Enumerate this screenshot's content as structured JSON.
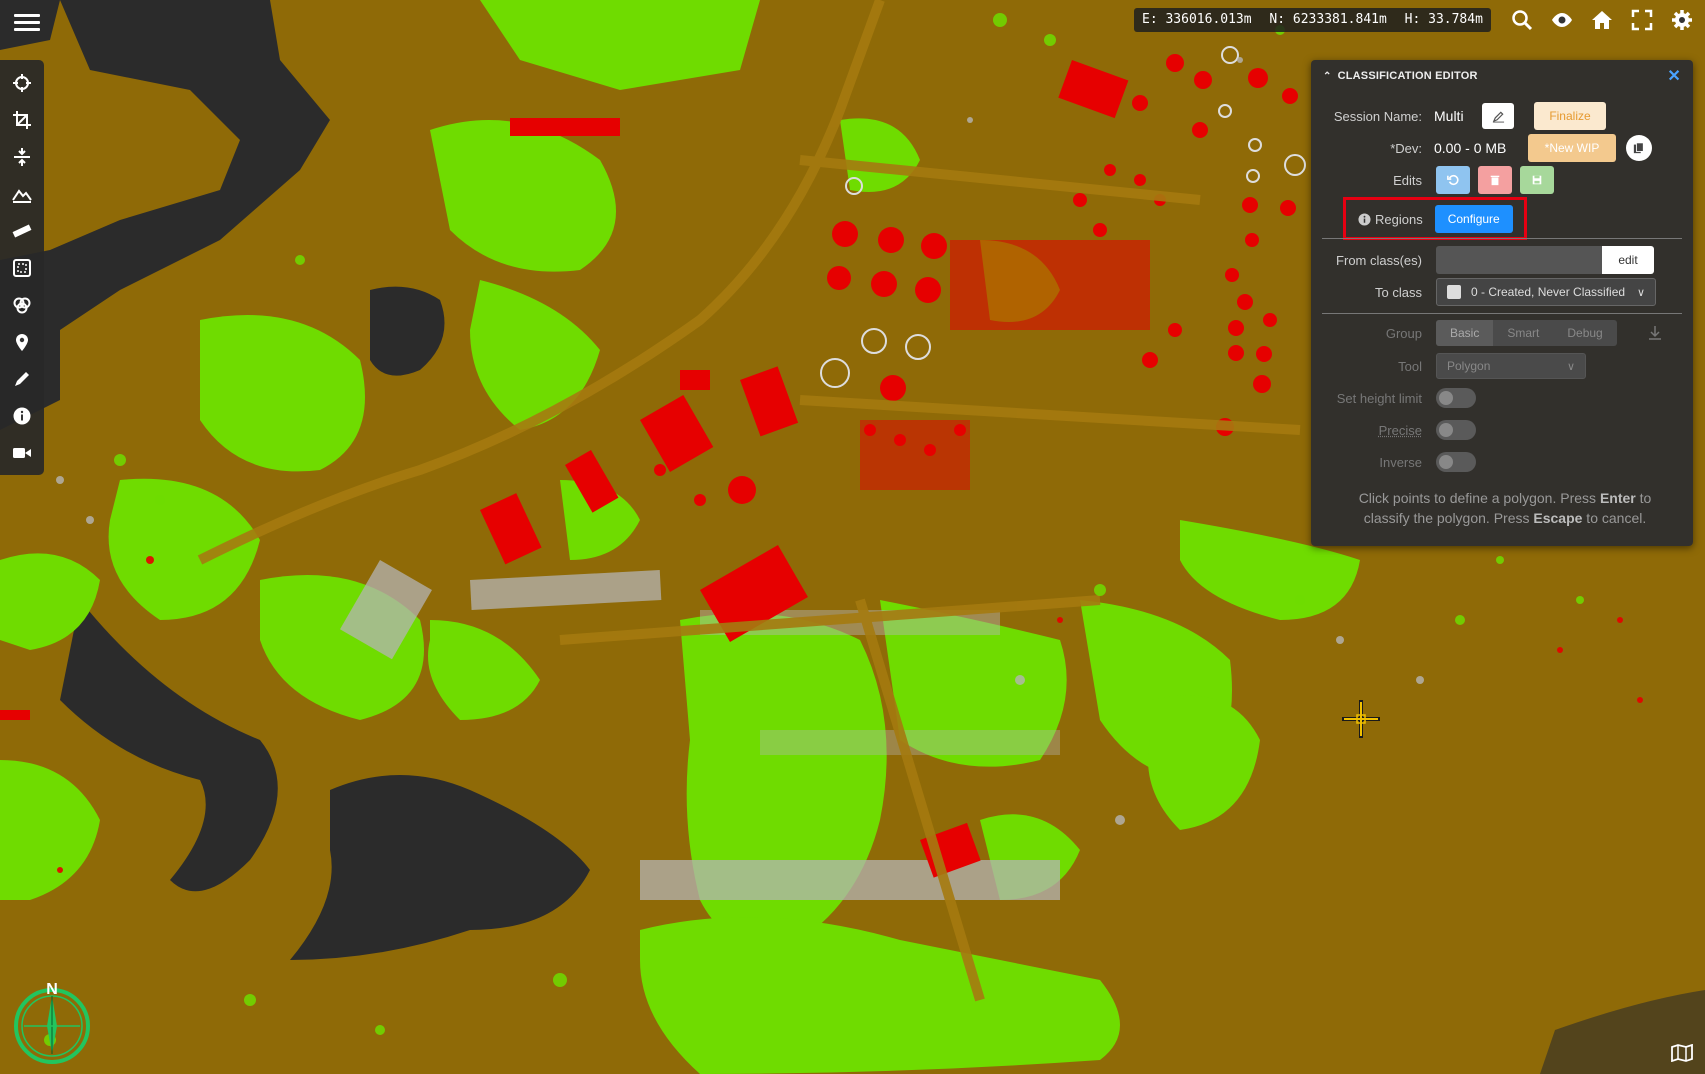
{
  "coordinates": {
    "easting": "E: 336016.013m",
    "northing": "N: 6233381.841m",
    "height": "H: 33.784m"
  },
  "toolbar": {
    "tools": [
      "target-icon",
      "crop-icon",
      "split-vertical-icon",
      "terrain-icon",
      "ruler-icon",
      "crop-box-icon",
      "layers-icon",
      "location-pin-icon",
      "pencil-icon",
      "info-icon",
      "video-camera-icon"
    ]
  },
  "top_icons": [
    "search-icon",
    "eye-icon",
    "home-icon",
    "fullscreen-icon",
    "gear-icon"
  ],
  "panel": {
    "title": "CLASSIFICATION EDITOR",
    "session_label": "Session Name:",
    "session_value": "Multi",
    "finalize_label": "Finalize",
    "dev_label": "*Dev:",
    "dev_value": "0.00 - 0 MB",
    "new_wip_label": "*New WIP",
    "edits_label": "Edits",
    "regions_label": "Regions",
    "configure_label": "Configure",
    "from_class_label": "From class(es)",
    "from_class_value": "",
    "edit_label": "edit",
    "to_class_label": "To class",
    "to_class_value": "0 - Created, Never Classified",
    "group_label": "Group",
    "group_options": [
      "Basic",
      "Smart",
      "Debug"
    ],
    "group_selected": "Basic",
    "tool_label": "Tool",
    "tool_value": "Polygon",
    "height_limit_label": "Set height limit",
    "precise_label": "Precise",
    "inverse_label": "Inverse",
    "hint_prefix": "Click points to define a polygon. Press ",
    "hint_key1": "Enter",
    "hint_mid": " to classify the polygon. Press ",
    "hint_key2": "Escape",
    "hint_suffix": " to cancel."
  },
  "compass": {
    "label": "N"
  },
  "colors": {
    "ground": "#8f6a07",
    "vegetation": "#6fdc00",
    "building": "#e60000",
    "water": "#2b2b2b",
    "unclassified": "#b5b5b5",
    "accent": "#1e90ff"
  }
}
